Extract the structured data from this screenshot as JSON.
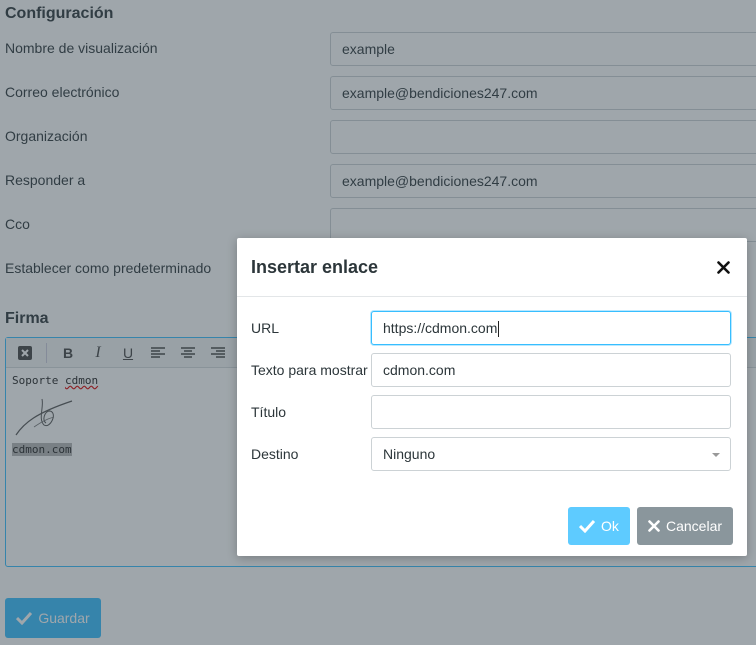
{
  "settings": {
    "title": "Configuración",
    "fields": [
      {
        "label": "Nombre de visualización",
        "value": "example"
      },
      {
        "label": "Correo electrónico",
        "value": "example@bendiciones247.com"
      },
      {
        "label": "Organización",
        "value": ""
      },
      {
        "label": "Responder a",
        "value": "example@bendiciones247.com"
      },
      {
        "label": "Cco",
        "value": ""
      },
      {
        "label": "Establecer como predeterminado",
        "value": ""
      }
    ]
  },
  "signature": {
    "title": "Firma",
    "line1_prefix": "Soporte ",
    "line1_word": "cdmon",
    "link_text": "cdmon.com"
  },
  "save_button": {
    "label": "Guardar"
  },
  "dialog": {
    "title": "Insertar enlace",
    "url_label": "URL",
    "url_value": "https://cdmon.com",
    "text_label": "Texto para mostrar",
    "text_value": "cdmon.com",
    "title_label": "Título",
    "title_value": "",
    "target_label": "Destino",
    "target_value": "Ninguno",
    "ok_label": "Ok",
    "cancel_label": "Cancelar"
  },
  "colors": {
    "accent": "#37beff",
    "cancel": "#8a969c"
  }
}
